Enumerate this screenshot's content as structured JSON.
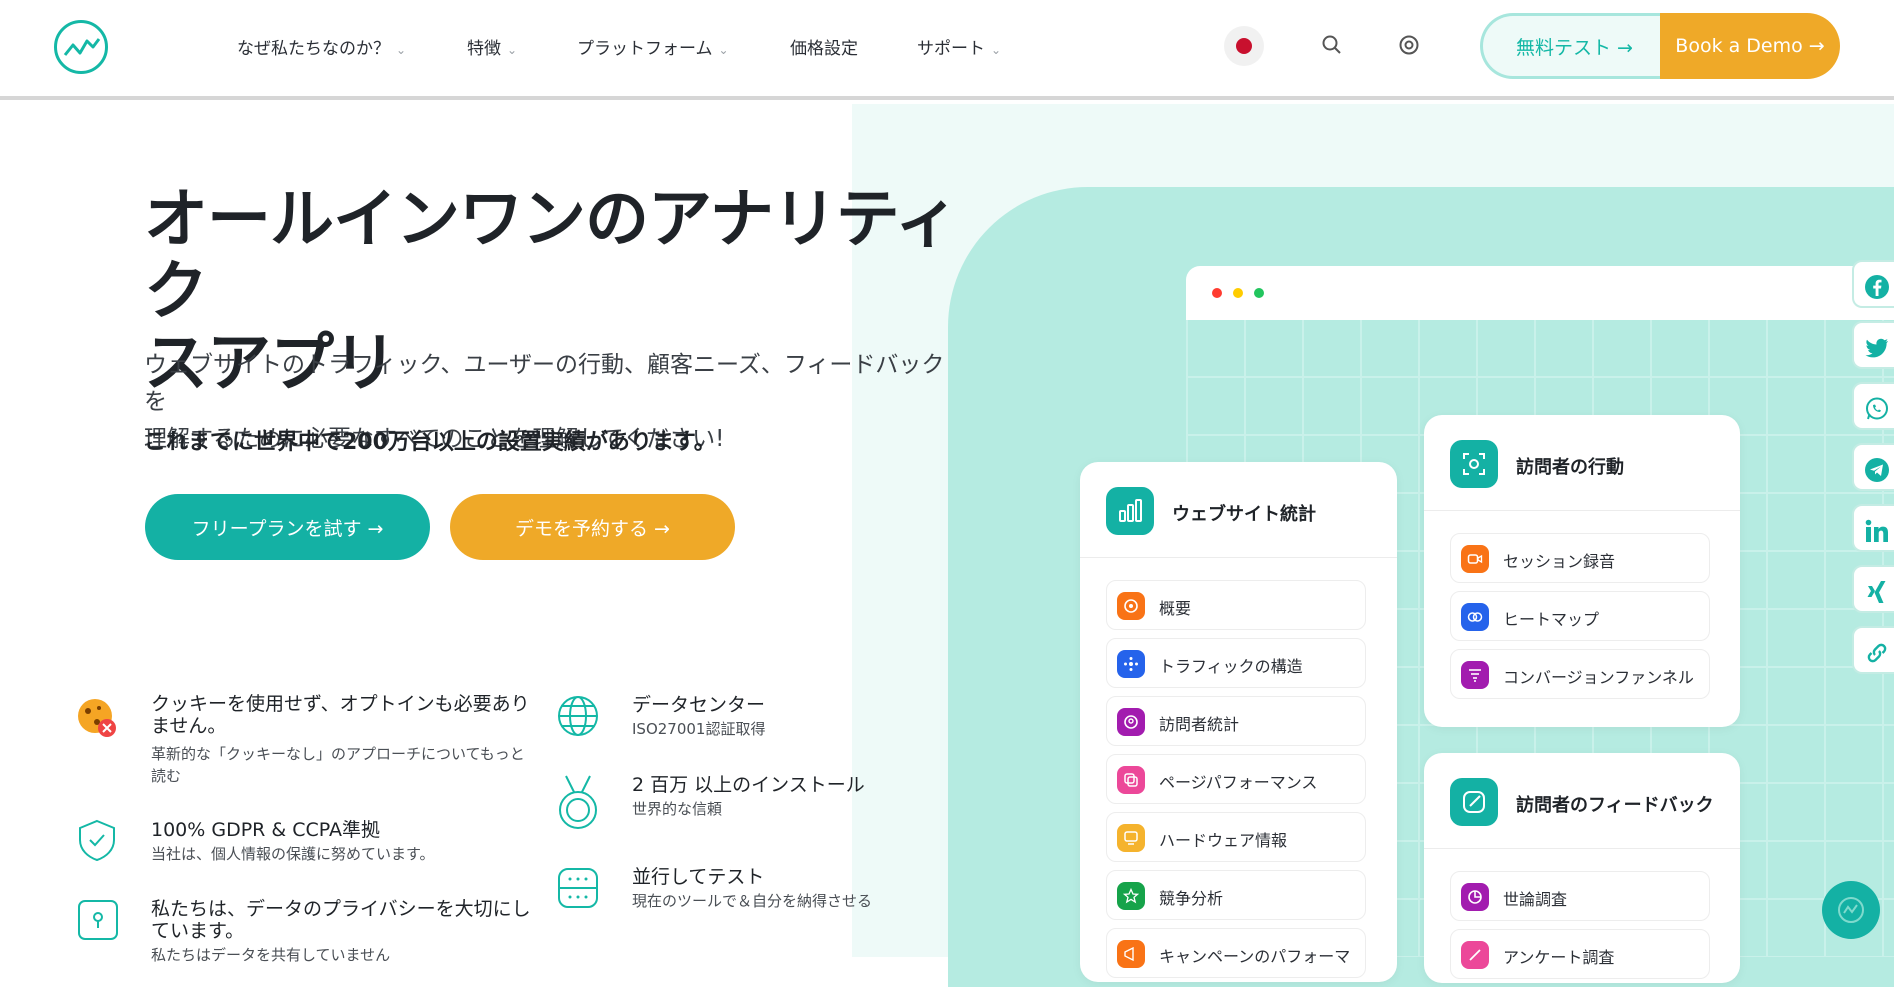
{
  "brand": {
    "accent": "#14b1a4",
    "orange": "#efa928"
  },
  "header": {
    "nav": [
      {
        "label": "なぜ私たちなのか？",
        "has_dropdown": true
      },
      {
        "label": "特徴",
        "has_dropdown": true
      },
      {
        "label": "プラットフォーム",
        "has_dropdown": true
      },
      {
        "label": "価格設定",
        "has_dropdown": false
      },
      {
        "label": "サポート",
        "has_dropdown": true
      }
    ],
    "free_test_label": "無料テスト →",
    "demo_label": "Book a Demo →",
    "icons": [
      "japan-flag-icon",
      "search-icon",
      "at-sign-icon"
    ]
  },
  "hero": {
    "title_line1": "オールインワンのアナリティク",
    "title_line2": "スアプリ",
    "desc_line1": "ウェブサイトのトラフィック、ユーザーの行動、顧客ニーズ、フィードバックを",
    "desc_line2": "理解するために必要なすべてのことを理解してください!",
    "strong": "これまでに世界中で200万台以上の設置実績があります。",
    "cta_primary": "フリープランを試す →",
    "cta_secondary": "デモを予約する →"
  },
  "features_left": [
    {
      "title": "クッキーを使用せず、オプトインも必要ありません。",
      "sub": "革新的な「クッキーなし」のアプローチについてもっと読む",
      "icon": "cookie-blocked-icon"
    },
    {
      "title": "100% GDPR & CCPA準拠",
      "sub": "当社は、個人情報の保護に努めています。",
      "icon": "shield-check-icon"
    },
    {
      "title": "私たちは、データのプライバシーを大切にしています。",
      "sub": "私たちはデータを共有していません",
      "icon": "lock-keyhole-icon"
    }
  ],
  "features_right": [
    {
      "title": "データセンター",
      "sub": "ISO27001認証取得",
      "icon": "globe-icon"
    },
    {
      "title": "2 百万 以上のインストール",
      "sub": "世界的な信頼",
      "icon": "medal-icon"
    },
    {
      "title": "並行してテスト",
      "sub": "現在のツールで＆自分を納得させる",
      "icon": "browser-window-icon"
    }
  ],
  "cards": {
    "website_stats": {
      "title": "ウェブサイト統計",
      "items": [
        {
          "label": "概要",
          "color": "#f97316"
        },
        {
          "label": "トラフィックの構造",
          "color": "#2563eb"
        },
        {
          "label": "訪問者統計",
          "color": "#a21caf"
        },
        {
          "label": "ページパフォーマンス",
          "color": "#ec4899"
        },
        {
          "label": "ハードウェア情報",
          "color": "#f5b32d"
        },
        {
          "label": "競争分析",
          "color": "#16a34a"
        },
        {
          "label": "キャンペーンのパフォーマ",
          "color": "#f97316"
        }
      ]
    },
    "visitor_behavior": {
      "title": "訪問者の行動",
      "items": [
        {
          "label": "セッション録音",
          "color": "#f97316"
        },
        {
          "label": "ヒートマップ",
          "color": "#2563eb"
        },
        {
          "label": "コンバージョンファンネル",
          "color": "#a21caf"
        }
      ]
    },
    "visitor_feedback": {
      "title": "訪問者のフィードバック",
      "items": [
        {
          "label": "世論調査",
          "color": "#a21caf"
        },
        {
          "label": "アンケート調査",
          "color": "#ec4899"
        }
      ]
    }
  },
  "social": [
    "facebook-icon",
    "twitter-icon",
    "whatsapp-icon",
    "telegram-icon",
    "linkedin-icon",
    "xing-icon",
    "link-icon"
  ]
}
